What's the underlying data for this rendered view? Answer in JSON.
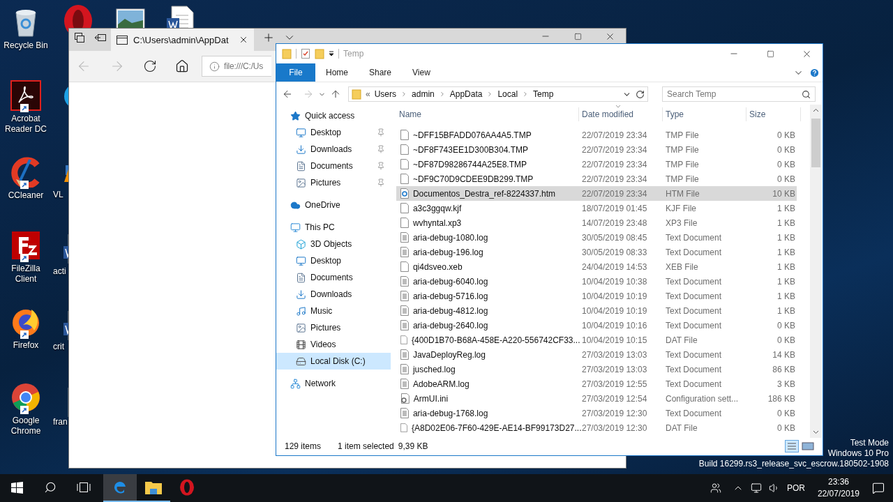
{
  "desktop": {
    "top_icons": [
      {
        "kind": "opera"
      },
      {
        "kind": "photo"
      },
      {
        "kind": "word"
      }
    ],
    "icons": [
      {
        "label": "Recycle Bin",
        "kind": "recycle"
      },
      {
        "label": "Acrobat Reader DC",
        "kind": "acrobat"
      },
      {
        "label": "CCleaner",
        "kind": "ccleaner"
      },
      {
        "label": "FileZilla Client",
        "kind": "filezilla"
      },
      {
        "label": "Firefox",
        "kind": "firefox"
      },
      {
        "label": "Google Chrome",
        "kind": "chrome"
      }
    ],
    "partial_icons": [
      {
        "kind": "skype"
      },
      {
        "label": "VL",
        "kind": "vlc"
      },
      {
        "label": "acti",
        "kind": "word"
      },
      {
        "label": "crit",
        "kind": "word"
      },
      {
        "label": "fran",
        "kind": "pdf"
      }
    ],
    "system_text": [
      "Test Mode",
      "Windows 10 Pro",
      "Build 16299.rs3_release_svc_escrow.180502-1908"
    ]
  },
  "browser": {
    "tab_title": "C:\\Users\\admin\\AppDat",
    "address": "file:///C:/Us"
  },
  "explorer": {
    "title": "Temp",
    "file_tab": "File",
    "ribbon_tabs": [
      "Home",
      "Share",
      "View"
    ],
    "breadcrumb_lead": "«",
    "breadcrumb": [
      "Users",
      "admin",
      "AppData",
      "Local",
      "Temp"
    ],
    "search": {
      "placeholder": "Search Temp"
    },
    "nav": [
      {
        "label": "Quick access",
        "kind": "star",
        "selected": false,
        "children": [
          {
            "label": "Desktop",
            "kind": "desktop",
            "pinned": true,
            "selected": false
          },
          {
            "label": "Downloads",
            "kind": "download",
            "pinned": true,
            "selected": false
          },
          {
            "label": "Documents",
            "kind": "document",
            "pinned": true,
            "selected": false
          },
          {
            "label": "Pictures",
            "kind": "picture",
            "pinned": true,
            "selected": false
          }
        ]
      },
      {
        "label": "OneDrive",
        "kind": "cloud",
        "selected": false
      },
      {
        "label": "This PC",
        "kind": "pc",
        "selected": false,
        "children": [
          {
            "label": "3D Objects",
            "kind": "cube",
            "selected": false
          },
          {
            "label": "Desktop",
            "kind": "desktop",
            "selected": false
          },
          {
            "label": "Documents",
            "kind": "document",
            "selected": false
          },
          {
            "label": "Downloads",
            "kind": "download",
            "selected": false
          },
          {
            "label": "Music",
            "kind": "music",
            "selected": false
          },
          {
            "label": "Pictures",
            "kind": "picture",
            "selected": false
          },
          {
            "label": "Videos",
            "kind": "video",
            "selected": false
          },
          {
            "label": "Local Disk (C:)",
            "kind": "disk",
            "selected": true
          }
        ]
      },
      {
        "label": "Network",
        "kind": "network",
        "selected": false
      }
    ],
    "columns": [
      "Name",
      "Date modified",
      "Type",
      "Size"
    ],
    "files": [
      {
        "name": "~DFF15BFADD076AA4A5.TMP",
        "date": "22/07/2019 23:34",
        "type": "TMP File",
        "size": "0 KB",
        "kind": "blank",
        "selected": false
      },
      {
        "name": "~DF8F743EE1D300B304.TMP",
        "date": "22/07/2019 23:34",
        "type": "TMP File",
        "size": "0 KB",
        "kind": "blank",
        "selected": false
      },
      {
        "name": "~DF87D98286744A25E8.TMP",
        "date": "22/07/2019 23:34",
        "type": "TMP File",
        "size": "0 KB",
        "kind": "blank",
        "selected": false
      },
      {
        "name": "~DF9C70D9CDEE9DB299.TMP",
        "date": "22/07/2019 23:34",
        "type": "TMP File",
        "size": "0 KB",
        "kind": "blank",
        "selected": false
      },
      {
        "name": "Documentos_Destra_ref-8224337.htm",
        "date": "22/07/2019 23:34",
        "type": "HTM File",
        "size": "10 KB",
        "kind": "edge",
        "selected": true
      },
      {
        "name": "a3c3ggqw.kjf",
        "date": "18/07/2019 01:45",
        "type": "KJF File",
        "size": "1 KB",
        "kind": "blank",
        "selected": false
      },
      {
        "name": "wvhyntal.xp3",
        "date": "14/07/2019 23:48",
        "type": "XP3 File",
        "size": "1 KB",
        "kind": "blank",
        "selected": false
      },
      {
        "name": "aria-debug-1080.log",
        "date": "30/05/2019 08:45",
        "type": "Text Document",
        "size": "1 KB",
        "kind": "text",
        "selected": false
      },
      {
        "name": "aria-debug-196.log",
        "date": "30/05/2019 08:33",
        "type": "Text Document",
        "size": "1 KB",
        "kind": "text",
        "selected": false
      },
      {
        "name": "qi4dsveo.xeb",
        "date": "24/04/2019 14:53",
        "type": "XEB File",
        "size": "1 KB",
        "kind": "blank",
        "selected": false
      },
      {
        "name": "aria-debug-6040.log",
        "date": "10/04/2019 10:38",
        "type": "Text Document",
        "size": "1 KB",
        "kind": "text",
        "selected": false
      },
      {
        "name": "aria-debug-5716.log",
        "date": "10/04/2019 10:19",
        "type": "Text Document",
        "size": "1 KB",
        "kind": "text",
        "selected": false
      },
      {
        "name": "aria-debug-4812.log",
        "date": "10/04/2019 10:19",
        "type": "Text Document",
        "size": "1 KB",
        "kind": "text",
        "selected": false
      },
      {
        "name": "aria-debug-2640.log",
        "date": "10/04/2019 10:16",
        "type": "Text Document",
        "size": "0 KB",
        "kind": "text",
        "selected": false
      },
      {
        "name": "{400D1B70-B68A-458E-A220-556742CF33...",
        "date": "10/04/2019 10:15",
        "type": "DAT File",
        "size": "0 KB",
        "kind": "blank",
        "selected": false
      },
      {
        "name": "JavaDeployReg.log",
        "date": "27/03/2019 13:03",
        "type": "Text Document",
        "size": "14 KB",
        "kind": "text",
        "selected": false
      },
      {
        "name": "jusched.log",
        "date": "27/03/2019 13:03",
        "type": "Text Document",
        "size": "86 KB",
        "kind": "text",
        "selected": false
      },
      {
        "name": "AdobeARM.log",
        "date": "27/03/2019 12:55",
        "type": "Text Document",
        "size": "3 KB",
        "kind": "text",
        "selected": false
      },
      {
        "name": "ArmUI.ini",
        "date": "27/03/2019 12:54",
        "type": "Configuration sett...",
        "size": "186 KB",
        "kind": "settings",
        "selected": false
      },
      {
        "name": "aria-debug-1768.log",
        "date": "27/03/2019 12:30",
        "type": "Text Document",
        "size": "0 KB",
        "kind": "text",
        "selected": false
      },
      {
        "name": "{A8D02E06-7F60-429E-AE14-BF99173D27...",
        "date": "27/03/2019 12:30",
        "type": "DAT File",
        "size": "0 KB",
        "kind": "blank",
        "selected": false
      }
    ],
    "status": {
      "count": "129 items",
      "selection": "1 item selected",
      "size": "9,39 KB"
    }
  },
  "taskbar": {
    "apps": [
      {
        "kind": "edge",
        "active": true,
        "running": true
      },
      {
        "kind": "explorer",
        "active": false,
        "running": true
      },
      {
        "kind": "opera",
        "active": false,
        "running": false
      }
    ],
    "language": "POR",
    "time": "23:36",
    "date": "22/07/2019"
  }
}
